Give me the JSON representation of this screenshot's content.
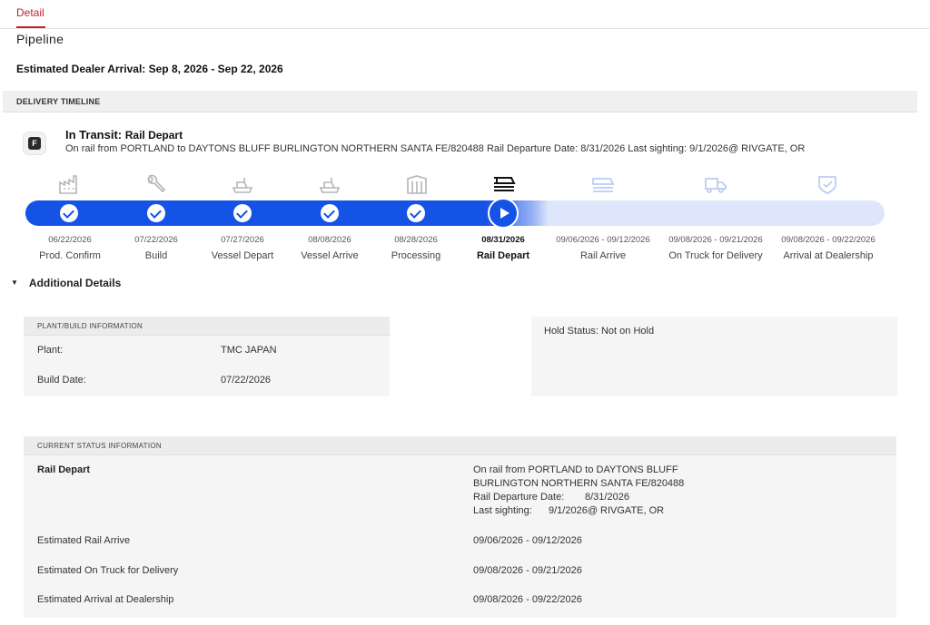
{
  "tabs": [
    {
      "label": "Detail",
      "active": true
    }
  ],
  "section_title": "Pipeline",
  "estimated_arrival": "Estimated Dealer Arrival: Sep 8, 2026 - Sep 22, 2026",
  "timeline": {
    "header": "DELIVERY TIMELINE",
    "badge_letter": "F",
    "status_prefix": "In Transit:",
    "status_stage": "Rail Depart",
    "status_description": "On rail from PORTLAND to DAYTONS BLUFF BURLINGTON NORTHERN SANTA FE/820488 Rail Departure Date: 8/31/2026 Last sighting: 9/1/2026@ RIVGATE, OR",
    "progress_completed_steps": 6,
    "progress_total_steps": 9,
    "accent_color": "#1552e6",
    "steps": [
      {
        "icon": "factory-icon",
        "date": "06/22/2026",
        "label": "Prod. Confirm",
        "state": "done"
      },
      {
        "icon": "wrench-icon",
        "date": "07/22/2026",
        "label": "Build",
        "state": "done"
      },
      {
        "icon": "ship-depart-icon",
        "date": "07/27/2026",
        "label": "Vessel Depart",
        "state": "done"
      },
      {
        "icon": "ship-arrive-icon",
        "date": "08/08/2026",
        "label": "Vessel Arrive",
        "state": "done"
      },
      {
        "icon": "processing-icon",
        "date": "08/28/2026",
        "label": "Processing",
        "state": "done"
      },
      {
        "icon": "train-icon",
        "date": "08/31/2026",
        "label": "Rail Depart",
        "state": "current"
      },
      {
        "icon": "rail-arrive-icon",
        "date": "09/06/2026 - 09/12/2026",
        "label": "Rail Arrive",
        "state": "pending"
      },
      {
        "icon": "truck-icon",
        "date": "09/08/2026 - 09/21/2026",
        "label": "On Truck for Delivery",
        "state": "pending"
      },
      {
        "icon": "shield-check-icon",
        "date": "09/08/2026 - 09/22/2026",
        "label": "Arrival at Dealership",
        "state": "pending"
      }
    ]
  },
  "additional": {
    "toggle_label": "Additional Details",
    "plant_panel": {
      "header": "PLANT/BUILD INFORMATION",
      "plant_label": "Plant:",
      "plant_value": "TMC JAPAN",
      "build_label": "Build Date:",
      "build_value": "07/22/2026"
    },
    "hold_status": "Hold Status: Not on Hold",
    "status_panel": {
      "header": "CURRENT STATUS INFORMATION",
      "stage_label": "Rail Depart",
      "stage_line1": "On rail from PORTLAND to DAYTONS BLUFF",
      "stage_line2": "BURLINGTON NORTHERN SANTA FE/820488",
      "departure_label": "Rail Departure Date:",
      "departure_value": "8/31/2026",
      "sighting_label": "Last sighting:",
      "sighting_value": "9/1/2026@ RIVGATE, OR",
      "rows": [
        {
          "label": "Estimated Rail Arrive",
          "value": "09/06/2026 - 09/12/2026"
        },
        {
          "label": "Estimated On Truck for Delivery",
          "value": "09/08/2026 - 09/21/2026"
        },
        {
          "label": "Estimated Arrival at Dealership",
          "value": "09/08/2026 - 09/22/2026"
        }
      ]
    }
  }
}
